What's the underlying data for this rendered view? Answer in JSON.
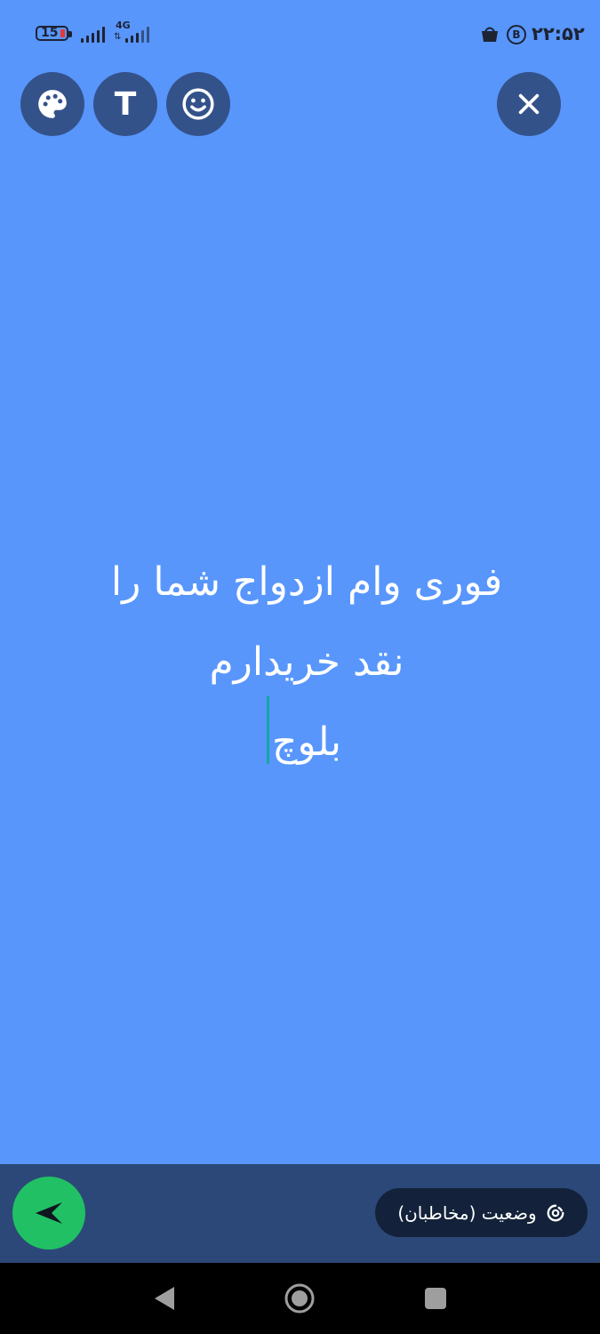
{
  "status_bar": {
    "battery_level": "15",
    "network_type": "4G",
    "time": "۲۲:۵۲"
  },
  "toolbar": {
    "text_button_glyph": "T",
    "icons": [
      "palette-icon",
      "text-icon",
      "emoji-icon",
      "close-icon"
    ]
  },
  "status_text": {
    "line1": "فوری وام ازدواج شما را",
    "line2": "نقد خریدارم",
    "line3": "بلوچ"
  },
  "bottom": {
    "audience_label": "وضعیت (مخاطبان)",
    "send_icon": "send-icon"
  },
  "colors": {
    "background": "#5896fc",
    "toolbar_button": "#34528a",
    "bottom_bar": "#2c4878",
    "send_button": "#21c064",
    "audience_pill": "#13223a",
    "caret": "#16a5a3"
  }
}
